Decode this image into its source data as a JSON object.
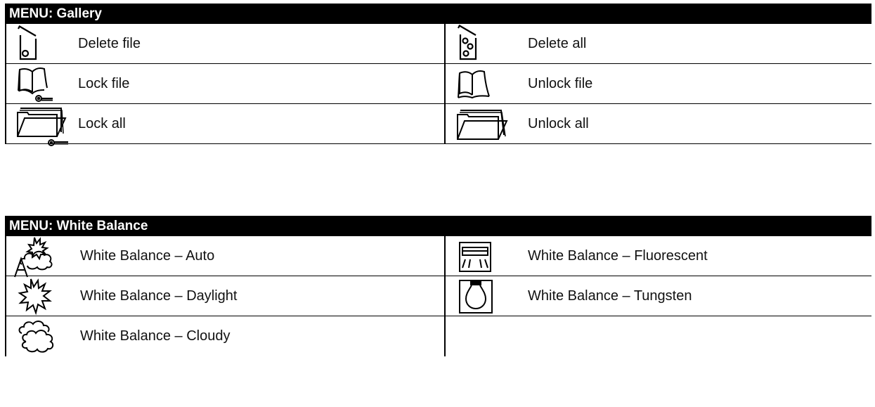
{
  "gallery": {
    "header": "MENU: Gallery",
    "rows": [
      {
        "left": {
          "label": "Delete file",
          "icon": "delete-file-icon"
        },
        "right": {
          "label": "Delete all",
          "icon": "delete-all-icon"
        }
      },
      {
        "left": {
          "label": "Lock file",
          "icon": "lock-file-icon"
        },
        "right": {
          "label": "Unlock file",
          "icon": "unlock-file-icon"
        }
      },
      {
        "left": {
          "label": "Lock all",
          "icon": "lock-all-icon"
        },
        "right": {
          "label": "Unlock all",
          "icon": "unlock-all-icon"
        }
      }
    ]
  },
  "white_balance": {
    "header": "MENU: White Balance",
    "rows": [
      {
        "left": {
          "label": "White Balance – Auto",
          "icon": "wb-auto-icon"
        },
        "right": {
          "label": "White Balance – Fluorescent",
          "icon": "wb-fluorescent-icon"
        }
      },
      {
        "left": {
          "label": "White Balance – Daylight",
          "icon": "wb-daylight-icon"
        },
        "right": {
          "label": "White Balance – Tungsten",
          "icon": "wb-tungsten-icon"
        }
      },
      {
        "left": {
          "label": "White Balance – Cloudy",
          "icon": "wb-cloudy-icon"
        },
        "right": {
          "label": "",
          "icon": ""
        }
      }
    ]
  }
}
